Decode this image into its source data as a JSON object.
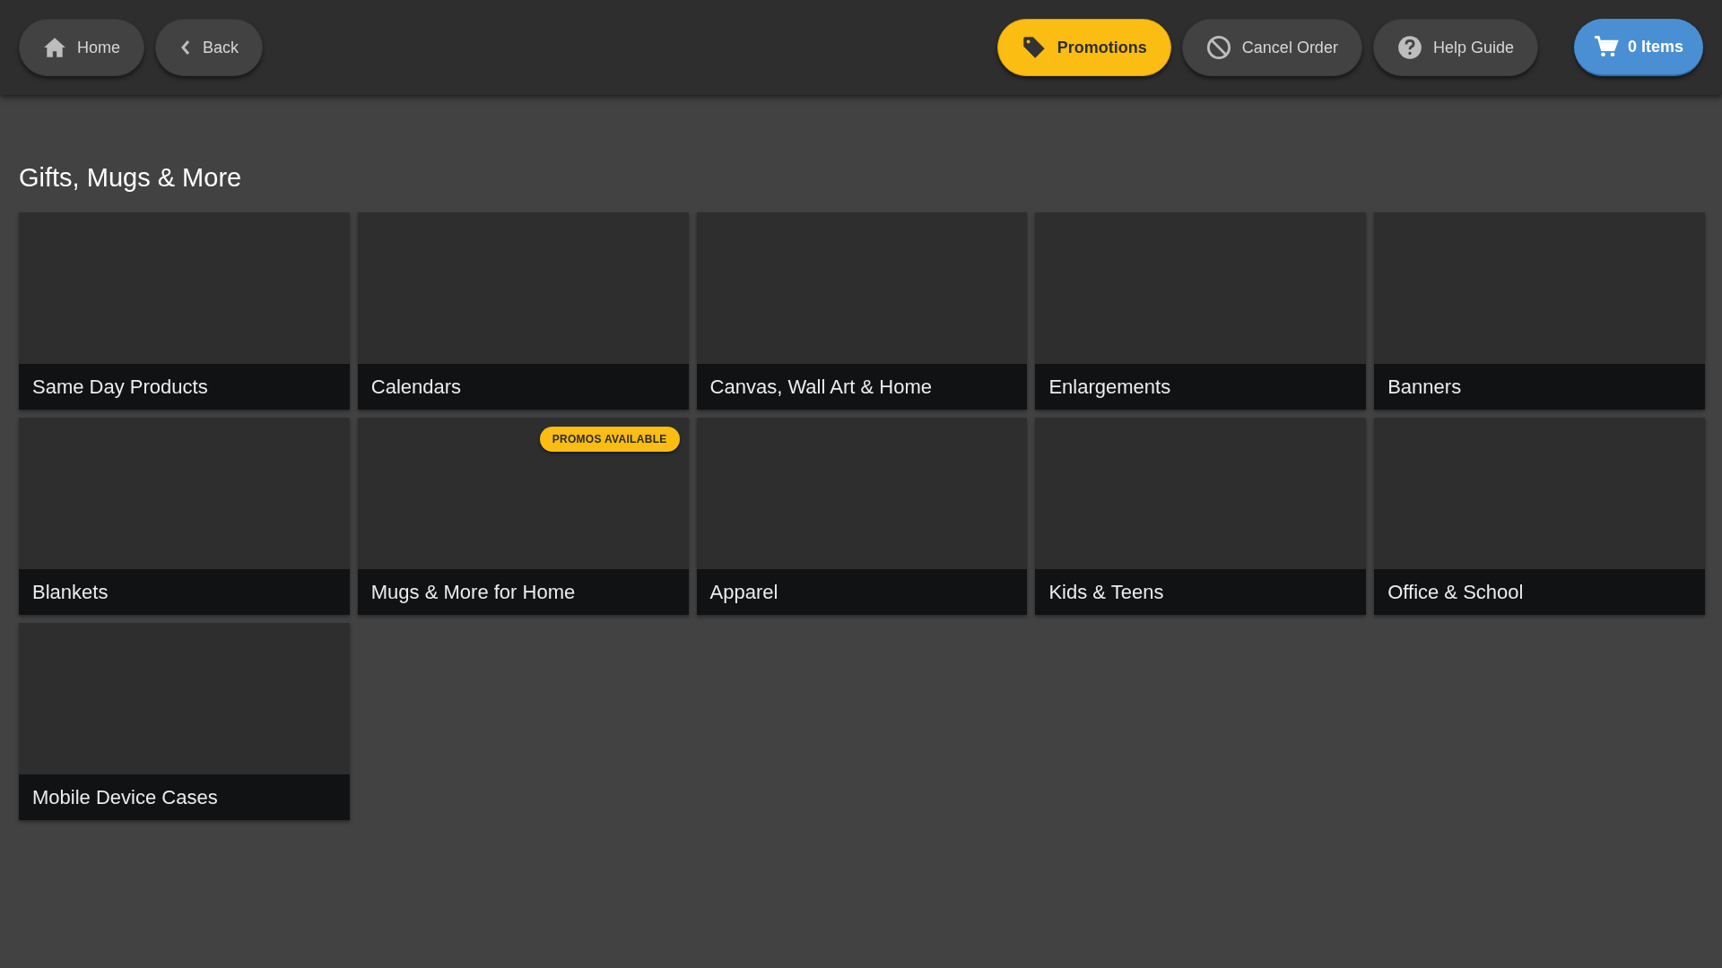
{
  "nav_left": [
    {
      "kind": "home",
      "label": "Home"
    },
    {
      "kind": "back",
      "label": "Back"
    }
  ],
  "nav_right": [
    {
      "kind": "promotions",
      "label": "Promotions"
    },
    {
      "kind": "cancel",
      "label": "Cancel Order"
    },
    {
      "kind": "help",
      "label": "Help Guide"
    }
  ],
  "cart": {
    "label": "0 Items"
  },
  "heading": "Gifts, Mugs & More",
  "tiles": [
    {
      "label": "Same Day Products"
    },
    {
      "label": "Calendars"
    },
    {
      "label": "Canvas, Wall Art & Home"
    },
    {
      "label": "Enlargements"
    },
    {
      "label": "Banners"
    },
    {
      "label": "Blankets"
    },
    {
      "label": "Mugs & More for Home",
      "badge": "PROMOS AVAILABLE"
    },
    {
      "label": "Apparel"
    },
    {
      "label": "Kids & Teens"
    },
    {
      "label": "Office & School"
    },
    {
      "label": "Mobile Device Cases"
    }
  ]
}
